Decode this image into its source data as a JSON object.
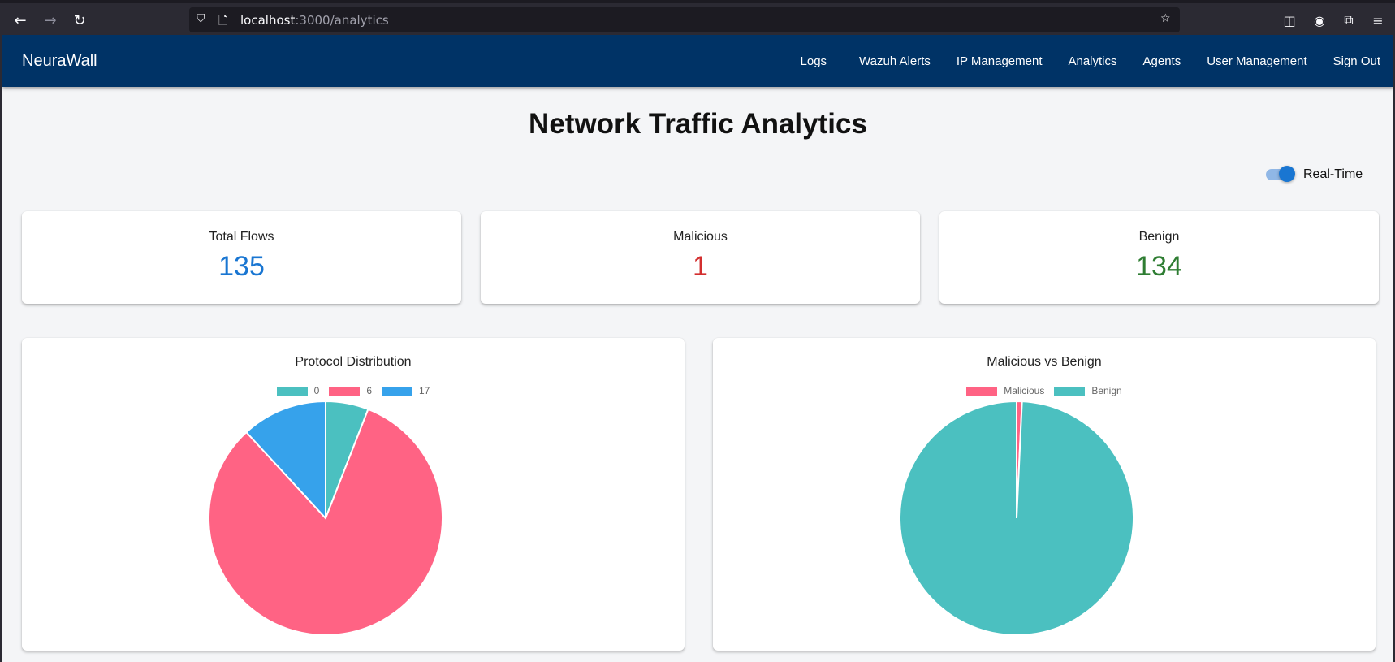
{
  "browser": {
    "url_host": "localhost",
    "url_path": ":3000/analytics"
  },
  "app": {
    "brand": "NeuraWall",
    "nav": [
      "Logs",
      "Wazuh Alerts",
      "IP Management",
      "Analytics",
      "Agents",
      "User Management",
      "Sign Out"
    ]
  },
  "page": {
    "title": "Network Traffic Analytics",
    "realtime_label": "Real-Time",
    "realtime_on": true
  },
  "stats": [
    {
      "label": "Total Flows",
      "value": "135",
      "color": "#1976d2"
    },
    {
      "label": "Malicious",
      "value": "1",
      "color": "#d32f2f"
    },
    {
      "label": "Benign",
      "value": "134",
      "color": "#2e7d32"
    }
  ],
  "charts": {
    "protocol": {
      "title": "Protocol Distribution"
    },
    "mvb": {
      "title": "Malicious vs Benign"
    }
  },
  "chart_data": [
    {
      "type": "pie",
      "title": "Protocol Distribution",
      "categories": [
        "0",
        "6",
        "17"
      ],
      "values": [
        8,
        111,
        16
      ],
      "colors": [
        "#4bc0c0",
        "#ff6384",
        "#36a2eb"
      ]
    },
    {
      "type": "pie",
      "title": "Malicious vs Benign",
      "categories": [
        "Malicious",
        "Benign"
      ],
      "values": [
        1,
        134
      ],
      "colors": [
        "#ff6384",
        "#4bc0c0"
      ]
    }
  ]
}
